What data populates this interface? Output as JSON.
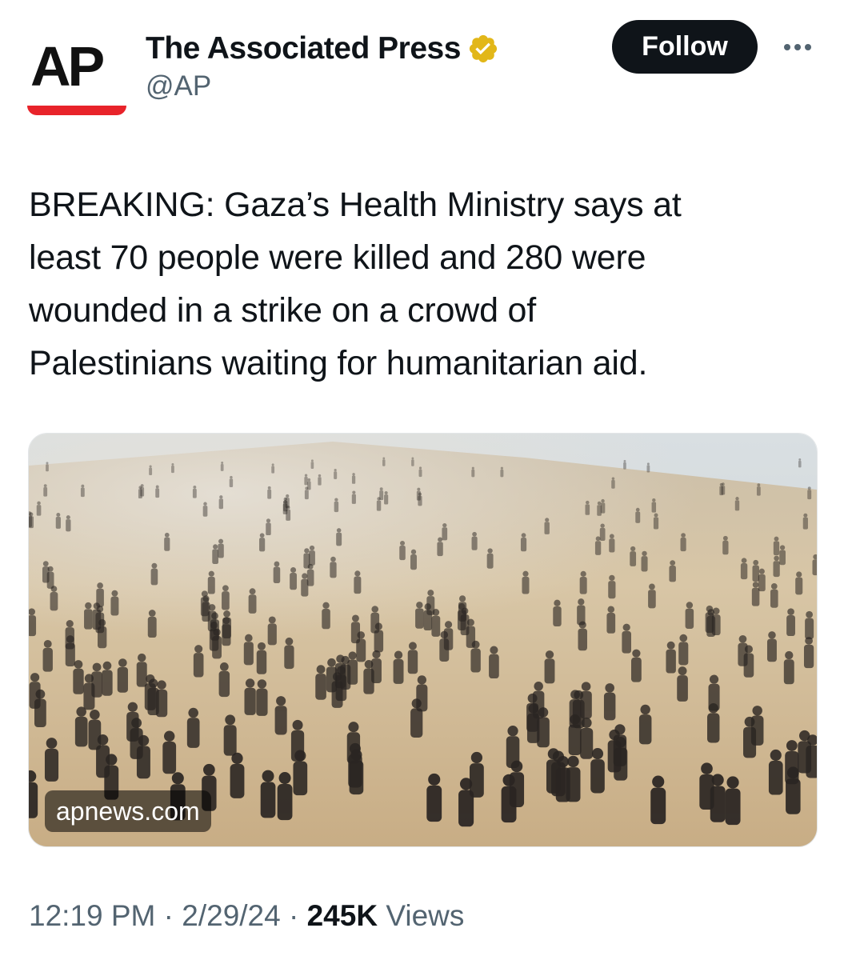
{
  "author": {
    "logo_text": "AP",
    "display_name": "The Associated Press",
    "handle": "@AP",
    "verified_icon": "gold-verified-badge",
    "brand_red": "#e8232a"
  },
  "header": {
    "follow_label": "Follow",
    "more_icon": "ellipsis-icon"
  },
  "tweet": {
    "text_lines": [
      "BREAKING: Gaza’s Health Ministry says at",
      "least 70 people were killed and 280 were",
      "wounded in a strike on a crowd of",
      "Palestinians waiting for humanitarian aid."
    ]
  },
  "media": {
    "source_label": "apnews.com"
  },
  "meta": {
    "time": "12:19 PM",
    "separator": "·",
    "date": "2/29/24",
    "views_count": "245K",
    "views_label": "Views"
  },
  "colors": {
    "text_primary": "#0f1419",
    "text_secondary": "#536471",
    "button_bg": "#0f1419",
    "verified_gold": "#e2b719"
  }
}
